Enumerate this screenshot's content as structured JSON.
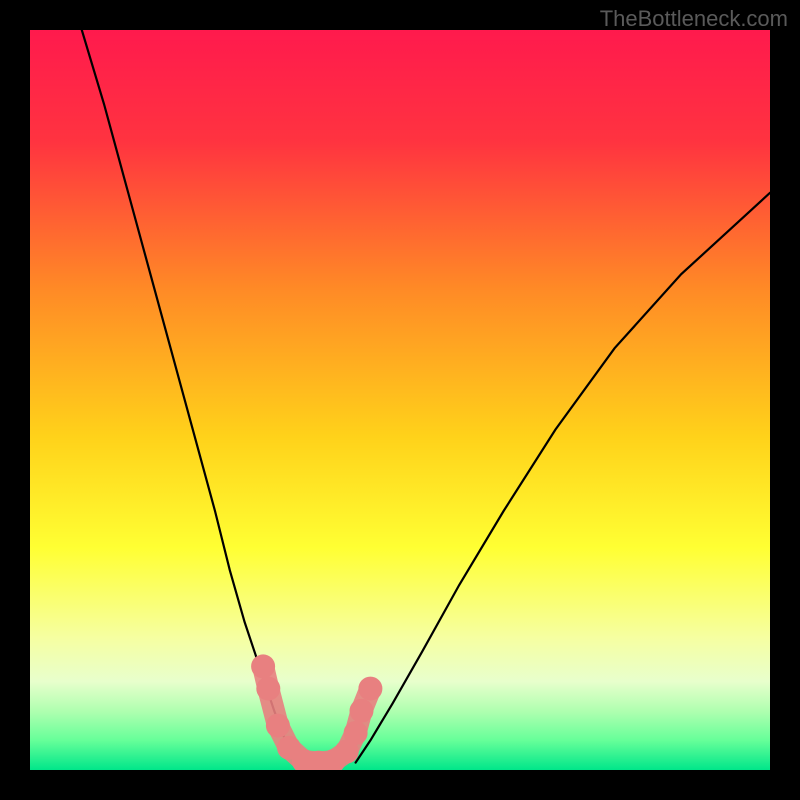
{
  "watermark": "TheBottleneck.com",
  "chart_data": {
    "type": "line",
    "title": "",
    "xlabel": "",
    "ylabel": "",
    "xlim": [
      0,
      100
    ],
    "ylim": [
      0,
      100
    ],
    "grid": false,
    "legend": false,
    "background_gradient_stops": [
      {
        "offset": 0.0,
        "color": "#ff1a4d"
      },
      {
        "offset": 0.15,
        "color": "#ff3340"
      },
      {
        "offset": 0.35,
        "color": "#ff8a26"
      },
      {
        "offset": 0.55,
        "color": "#ffd21a"
      },
      {
        "offset": 0.7,
        "color": "#ffff33"
      },
      {
        "offset": 0.82,
        "color": "#f6ffa0"
      },
      {
        "offset": 0.88,
        "color": "#e8ffcc"
      },
      {
        "offset": 0.92,
        "color": "#b0ffb0"
      },
      {
        "offset": 0.96,
        "color": "#66ff99"
      },
      {
        "offset": 1.0,
        "color": "#00e68a"
      }
    ],
    "series": [
      {
        "name": "left-curve",
        "color": "#000000",
        "x": [
          7,
          10,
          13,
          16,
          19,
          22,
          25,
          27,
          29,
          31,
          33,
          34.5,
          36
        ],
        "y": [
          100,
          90,
          79,
          68,
          57,
          46,
          35,
          27,
          20,
          14,
          8,
          4,
          1
        ]
      },
      {
        "name": "right-curve",
        "color": "#000000",
        "x": [
          44,
          46,
          49,
          53,
          58,
          64,
          71,
          79,
          88,
          100
        ],
        "y": [
          1,
          4,
          9,
          16,
          25,
          35,
          46,
          57,
          67,
          78
        ]
      },
      {
        "name": "marker-band",
        "type": "scatter",
        "color": "#e88080",
        "x": [
          31.5,
          32.2,
          33.5,
          35,
          37,
          39,
          41,
          42.8,
          44,
          44.8,
          46
        ],
        "y": [
          14,
          11,
          6,
          3,
          1.2,
          1,
          1.2,
          2.5,
          5,
          8,
          11
        ]
      }
    ]
  }
}
